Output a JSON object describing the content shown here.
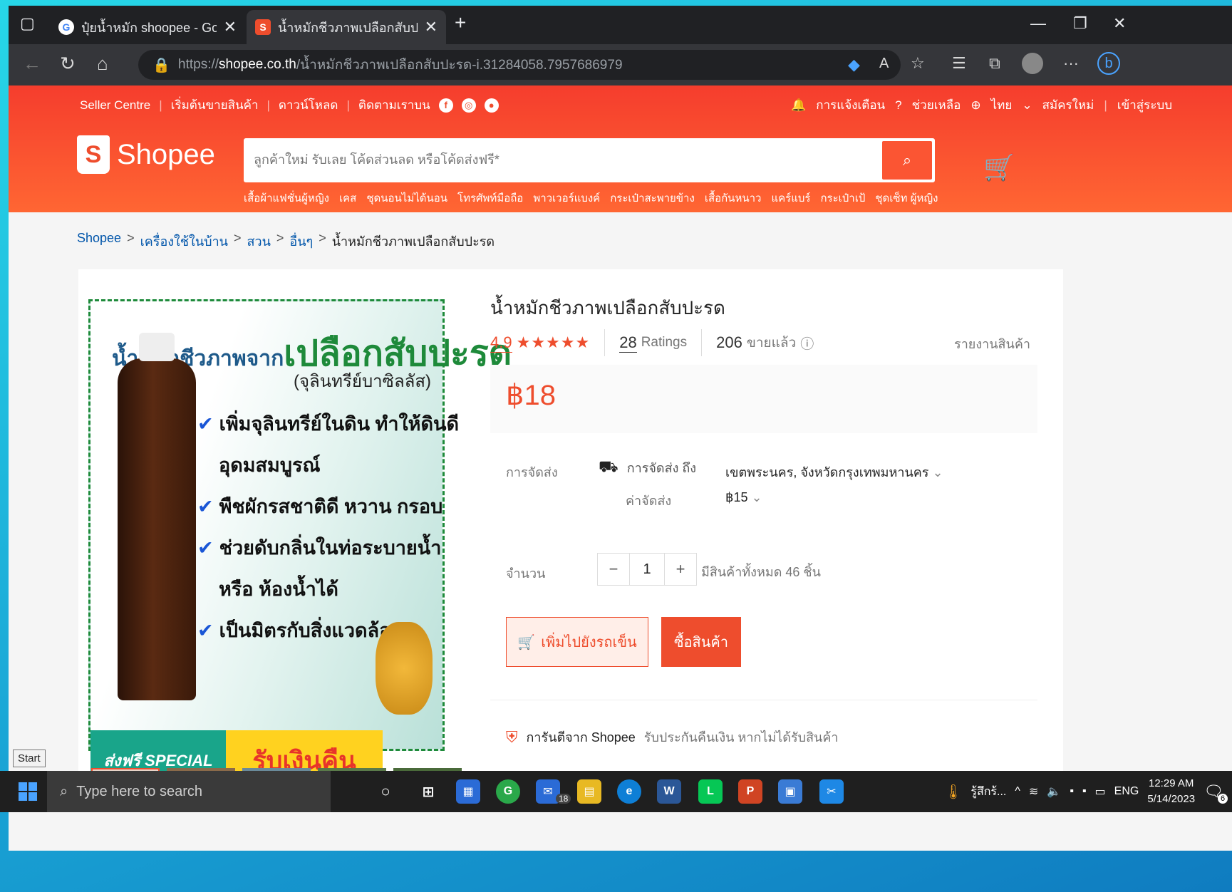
{
  "browser": {
    "tabs": [
      {
        "title": "ปุ๋ยน้ำหมัก shoopee - Google Sea",
        "icon": "google-icon"
      },
      {
        "title": "น้ำหมักชีวภาพเปลือกสับปะรด | Shop",
        "icon": "shopee-icon"
      }
    ],
    "url_prefix": "https://",
    "url_domain": "shopee.co.th",
    "url_path": "/น้ำหมักชีวภาพเปลือกสับปะรด-i.31284058.7957686979"
  },
  "shopee_header": {
    "top_links": [
      "Seller Centre",
      "เริ่มต้นขายสินค้า",
      "ดาวน์โหลด",
      "ติดตามเราบน"
    ],
    "notifications": "การแจ้งเตือน",
    "help": "ช่วยเหลือ",
    "language": "ไทย",
    "signup": "สมัครใหม่",
    "login": "เข้าสู่ระบบ",
    "logo_text": "Shopee",
    "search_placeholder": "ลูกค้าใหม่ รับเลย โค้ดส่วนลด หรือโค้ดส่งฟรี*",
    "keywords": [
      "เสื้อผ้าแฟชั่นผู้หญิง",
      "เคส",
      "ชุดนอนไม่ได้นอน",
      "โทรศัพท์มือถือ",
      "พาวเวอร์แบงค์",
      "กระเป๋าสะพายข้าง",
      "เสื้อกันหนาว",
      "แคร์แบร์",
      "กระเป๋าเป้",
      "ชุดเซ็ท ผู้หญิง"
    ]
  },
  "breadcrumb": [
    "Shopee",
    "เครื่องใช้ในบ้าน",
    "สวน",
    "อื่นๆ",
    "น้ำหมักชีวภาพเปลือกสับปะรด"
  ],
  "product_image": {
    "title_small": "น้ำหมักชีวภาพจาก",
    "title_big": "เปลือกสับปะรด",
    "subtitle": "(จุลินทรีย์บาซิลลัส)",
    "lines": [
      "เพิ่มจุลินทรีย์ในดิน ทำให้ดินดี",
      "อุดมสมบูรณ์",
      "พืชผักรสชาติดี หวาน กรอบ",
      "ช่วยดับกลิ่นในท่อระบายน้ำ",
      "หรือ ห้องน้ำได้",
      "เป็นมิตรกับสิ่งแวดล้อม"
    ],
    "banner_free": "ส่งฟรี SPECIAL",
    "banner_cashback": "รับเงินคืน"
  },
  "product": {
    "title": "น้ำหมักชีวภาพเปลือกสับปะรด",
    "rating": "4.9",
    "stars": "★★★★★",
    "ratings_count": "28",
    "ratings_label": "Ratings",
    "sold_count": "206",
    "sold_label": "ขายแล้ว",
    "report": "รายงานสินค้า",
    "price": "฿18",
    "shipping_label": "การจัดส่ง",
    "shipping_to": "การจัดส่ง ถึง",
    "shipping_location": "เขตพระนคร, จังหวัดกรุงเทพมหานคร",
    "shipping_fee_label": "ค่าจัดส่ง",
    "shipping_fee": "฿15",
    "quantity_label": "จำนวน",
    "quantity": "1",
    "stock": "มีสินค้าทั้งหมด 46 ชิ้น",
    "add_to_cart": "เพิ่มไปยังรถเข็น",
    "buy_now": "ซื้อสินค้า",
    "guarantee_title": "การันตีจาก Shopee",
    "guarantee_text": "รับประกันคืนเงิน หากไม่ได้รับสินค้า"
  },
  "taskbar": {
    "start_tooltip": "Start",
    "search_placeholder": "Type here to search",
    "mail_badge": "18",
    "weather": "รู้สึกร้...",
    "lang": "ENG",
    "time": "12:29 AM",
    "date": "5/14/2023",
    "notif_count": "6"
  }
}
